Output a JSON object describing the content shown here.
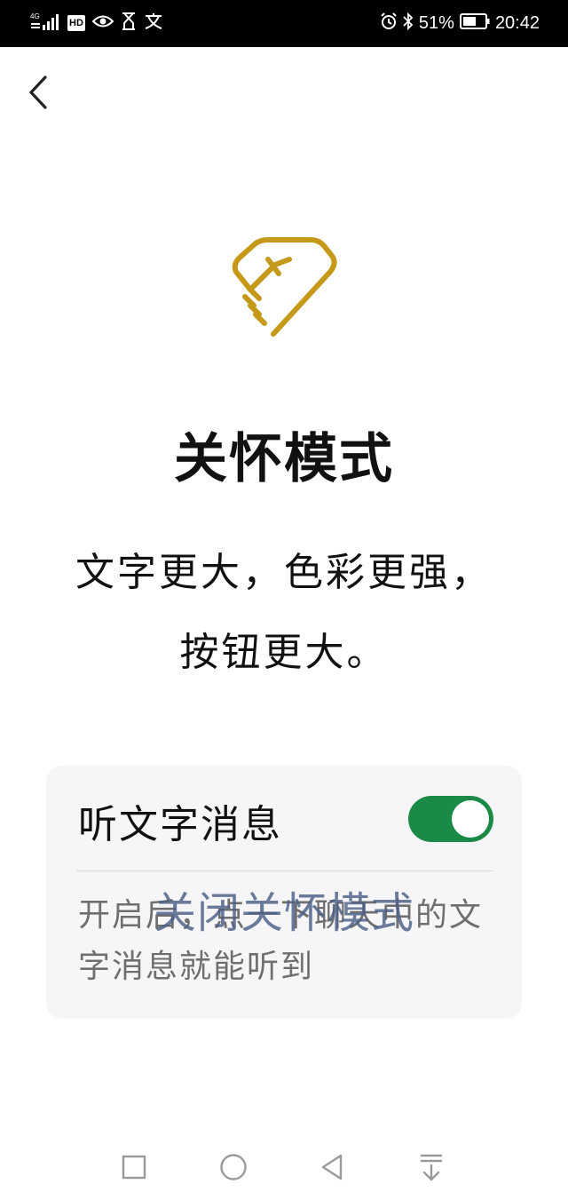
{
  "status_bar": {
    "network": "4G",
    "hd": "HD",
    "battery_percent": "51%",
    "time": "20:42"
  },
  "page": {
    "title": "关怀模式",
    "description_line1": "文字更大，色彩更强，",
    "description_line2": "按钮更大。"
  },
  "card": {
    "title": "听文字消息",
    "toggle_on": true,
    "description": "开启后，点一下聊天中的文字消息就能听到"
  },
  "exit_link": "关闭关怀模式",
  "colors": {
    "accent_gold": "#c59a1a",
    "toggle_green": "#1b8a47",
    "link_blue": "#4c5f86"
  },
  "icons": {
    "back": "chevron-left-icon",
    "logo": "heart-hand-icon",
    "nav": [
      "square-icon",
      "circle-icon",
      "triangle-back-icon",
      "download-icon"
    ]
  }
}
